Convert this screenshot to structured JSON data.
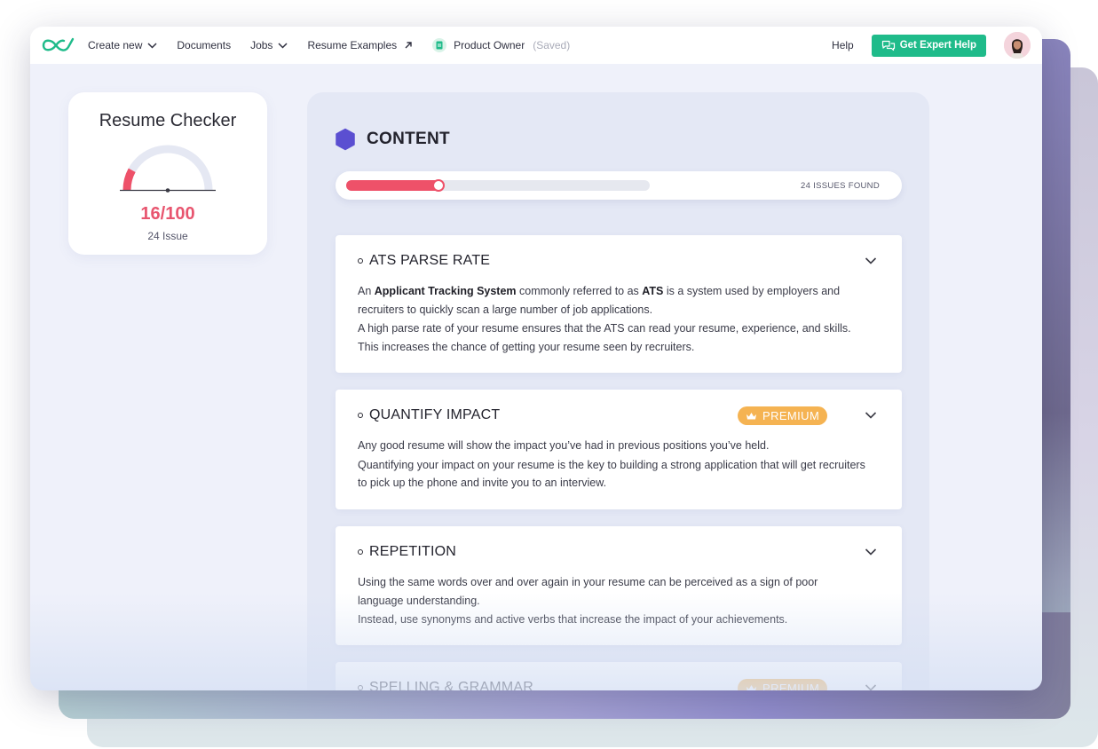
{
  "nav": {
    "create_new": "Create new",
    "documents": "Documents",
    "jobs": "Jobs",
    "resume_examples": "Resume Examples",
    "doc_name": "Product Owner",
    "doc_status": "(Saved)",
    "help": "Help",
    "expert_help": "Get Expert Help"
  },
  "checker": {
    "title": "Resume Checker",
    "score": "16/100",
    "score_value": 16,
    "score_max": 100,
    "issues": "24 Issue"
  },
  "content": {
    "title": "CONTENT",
    "progress_fraction": 0.31,
    "issues_found": "24 ISSUES FOUND",
    "premium_label": "PREMIUM",
    "sections": [
      {
        "title": "ATS PARSE RATE",
        "premium": false,
        "p1_a": "An ",
        "p1_b1": "Applicant Tracking System",
        "p1_c": " commonly referred to as ",
        "p1_b2": "ATS",
        "p1_d": " is a system used by employers and recruiters to quickly scan a large number of job applications.",
        "p2": "A high parse rate of your resume ensures that the ATS can read your resume, experience, and skills. This increases the chance of getting your resume seen by recruiters."
      },
      {
        "title": "QUANTIFY IMPACT",
        "premium": true,
        "p1": "Any good resume will show the impact you’ve had in previous positions you’ve held.",
        "p2": "Quantifying your impact on your resume is the key to building a strong application that will get recruiters to pick up the phone and invite you to an interview."
      },
      {
        "title": "REPETITION",
        "premium": false,
        "p1": "Using the same words over and over again in your resume can be perceived as a sign of poor language understanding.",
        "p2": "Instead, use synonyms and active verbs that increase the impact of your achievements."
      },
      {
        "title": "SPELLING & GRAMMAR",
        "premium": true
      }
    ]
  },
  "colors": {
    "accent_green": "#1fbb8a",
    "score_red": "#e8556f",
    "premium_orange": "#f5b352",
    "hex_purple": "#5b4fd1"
  },
  "icons": [
    "logo-icon",
    "chevron-down-icon",
    "external-link-icon",
    "document-icon",
    "chat-icon",
    "avatar",
    "hexagon-icon",
    "crown-icon"
  ]
}
